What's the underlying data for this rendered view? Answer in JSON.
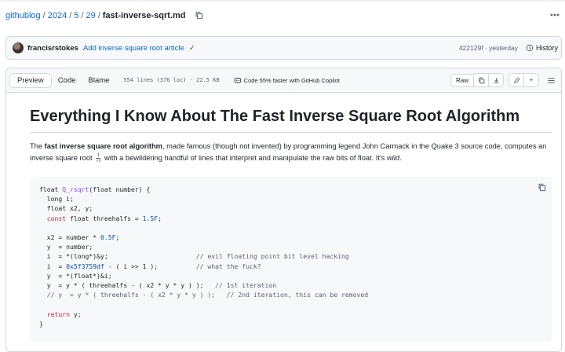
{
  "breadcrumb": {
    "repo": "githublog",
    "year": "2024",
    "month": "5",
    "day": "29",
    "file": "fast-inverse-sqrt.md"
  },
  "commit": {
    "author": "francisrstokes",
    "message": "Add inverse square root article",
    "hash": "422129f",
    "when": "yesterday",
    "history_label": "History"
  },
  "file_header": {
    "tabs": [
      "Preview",
      "Code",
      "Blame"
    ],
    "active_tab": "Preview",
    "meta": "554 lines (376 loc) · 22.5 KB",
    "copilot": "Code 55% faster with GitHub Copilot",
    "raw_label": "Raw"
  },
  "article": {
    "title": "Everything I Know About The Fast Inverse Square Root Algorithm",
    "p_the": "The ",
    "p_bold": "fast inverse square root algorithm",
    "p_rest": ", made famous (though not invented) by programming legend John Carmack in the Quake 3 source code, computes an inverse square root ",
    "frac_num": "1",
    "frac_den": "√x",
    "p_end": " with a bewildering handful of lines that interpret and manipulate the raw bits of float. It's ",
    "p_wild": "wild",
    "p_dot": "."
  },
  "code": {
    "lines": [
      "float Q_rsqrt(float number) {",
      "  long i;",
      "  float x2, y;",
      "  const float threehalfs = 1.5F;",
      "",
      "  x2 = number * 0.5F;",
      "  y  = number;",
      "  i  = *(long*)&y;                       // evil floating point bit level hacking",
      "  i  = 0x5f3759df - ( i >> 1 );          // what the fuck?",
      "  y  = *(float*)&i;",
      "  y  = y * ( threehalfs - ( x2 * y * y ) );   // 1st iteration",
      "  // y  = y * ( threehalfs - ( x2 * y * y ) );   // 2nd iteration, this can be removed",
      "",
      "  return y;",
      "}"
    ]
  },
  "icons": [
    "copy-icon",
    "kebab-icon",
    "history-icon",
    "copilot-icon",
    "download-icon",
    "pencil-icon",
    "chevron-down-icon",
    "list-icon",
    "check-icon"
  ],
  "colors": {
    "link": "#0969da",
    "keyword": "#cf222e",
    "function": "#8250df",
    "number": "#0550ae",
    "comment": "#59636e"
  }
}
